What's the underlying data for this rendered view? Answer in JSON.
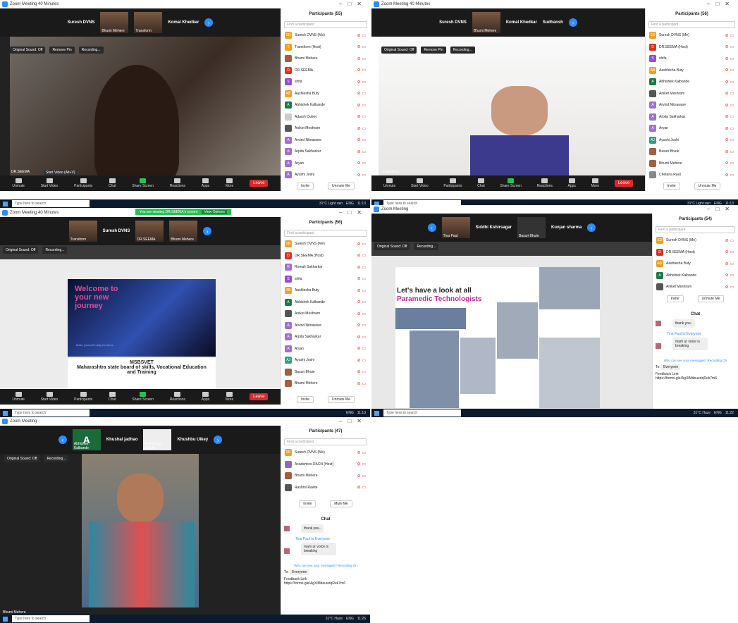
{
  "window_title": "Zoom Meeting 40 Minutes",
  "window_title_plain": "Zoom Meeting",
  "toolbar": {
    "unmute": "Unmute",
    "start_video": "Start Video",
    "participants": "Participants",
    "chat": "Chat",
    "share_screen": "Share Screen",
    "reactions": "Reactions",
    "apps": "Apps",
    "more": "More",
    "leave": "Leave",
    "view": "View"
  },
  "rec": {
    "original_sound": "Original Sound: Off",
    "remove_pin": "Remove Pin",
    "recording": "Recording..."
  },
  "taskbar": {
    "search": "Type here to search",
    "weather1": "31°C Light rain",
    "weather2": "31°C Haze",
    "lang": "ENG",
    "time1": "11:13",
    "time2": "11:22",
    "time3": "11:26",
    "date": "10-09-2022"
  },
  "shot1": {
    "strip_names": [
      "Suresh DVNS",
      "Bhumi Mehere",
      "Transform",
      "Komal Khedkar"
    ],
    "thumb_top": [
      "Suresh DVNS",
      "",
      "",
      "Komal Khedkar"
    ],
    "speaker": "DR.SEEMA",
    "tooltip": "Start Video (Alt+V)",
    "panel_title": "Participants (55)",
    "find": "Find a participant",
    "participants": [
      {
        "i": "SD",
        "n": "Suresh DVNS (Me)",
        "c": "#f0a020"
      },
      {
        "i": "T",
        "n": "Transform (Host)",
        "c": "#f0a020"
      },
      {
        "i": "",
        "n": "Bhumi Mehere",
        "c": "#a06040"
      },
      {
        "i": "D",
        "n": "DR.SEEMA",
        "c": "#e03020"
      },
      {
        "i": "S",
        "n": "shifa",
        "c": "#9050d0"
      },
      {
        "i": "AB",
        "n": "Aashlesha Buty",
        "c": "#f0a020"
      },
      {
        "i": "A",
        "n": "Abhishek Kalbande",
        "c": "#1a7a4a"
      },
      {
        "i": "",
        "n": "Adarsh Dubey",
        "c": "#ccc"
      },
      {
        "i": "",
        "n": "Aniket Meshram",
        "c": "#555"
      },
      {
        "i": "A",
        "n": "Arvind Nitnaware",
        "c": "#a070d0"
      },
      {
        "i": "A",
        "n": "Arpita Sakharkar",
        "c": "#a070d0"
      },
      {
        "i": "A",
        "n": "Aryan",
        "c": "#a070d0"
      },
      {
        "i": "A",
        "n": "Ayushi Joshi",
        "c": "#a070d0"
      }
    ],
    "invite": "Invite",
    "unmute_me": "Unmute Me"
  },
  "shot2": {
    "strip_names": [
      "Bhumi Mehere",
      "Komal Khedkar",
      "Sudhansh"
    ],
    "thumb_top": [
      "Suresh DVNS",
      "",
      "Komal Khedkar",
      "Sudhansh"
    ],
    "speaker": "Transform",
    "panel_title": "Participants (56)",
    "participants": [
      {
        "i": "SD",
        "n": "Suresh DVNS (Me)",
        "c": "#f0a020"
      },
      {
        "i": "D",
        "n": "DR.SEEMA (Host)",
        "c": "#e03020"
      },
      {
        "i": "S",
        "n": "shifa",
        "c": "#9050d0"
      },
      {
        "i": "AB",
        "n": "Aashlesha Buty",
        "c": "#f0a020"
      },
      {
        "i": "A",
        "n": "Abhishek Kalbande",
        "c": "#1a7a4a"
      },
      {
        "i": "",
        "n": "Aniket Meshram",
        "c": "#555"
      },
      {
        "i": "A",
        "n": "Arvind Nitnaware",
        "c": "#a070d0"
      },
      {
        "i": "A",
        "n": "Arpita Sakharkar",
        "c": "#a070d0"
      },
      {
        "i": "A",
        "n": "Aryan",
        "c": "#a070d0"
      },
      {
        "i": "AJ",
        "n": "Ayushi Joshi",
        "c": "#2aa080"
      },
      {
        "i": "",
        "n": "Basuri Bhute",
        "c": "#a06040"
      },
      {
        "i": "",
        "n": "Bhumi Mehere",
        "c": "#a06040"
      },
      {
        "i": "",
        "n": "Chetana Raut",
        "c": "#888"
      }
    ]
  },
  "shot3": {
    "banner": "You are viewing DR.SEEMA's screen",
    "view_options": "View Options",
    "strip_names": [
      "Transform",
      "DR.SEEMA",
      "Bhumi Mehere"
    ],
    "thumb_top": "Suresh DVNS",
    "panel_title": "Participants (56)",
    "participants": [
      {
        "i": "SD",
        "n": "Suresh DVNS (Me)",
        "c": "#f0a020"
      },
      {
        "i": "D",
        "n": "DR.SEEMA (Host)",
        "c": "#e03020"
      },
      {
        "i": "R",
        "n": "Romali Sakharkar",
        "c": "#a070d0"
      },
      {
        "i": "S",
        "n": "shifa",
        "c": "#9050d0"
      },
      {
        "i": "AB",
        "n": "Aashlesha Buty",
        "c": "#f0a020"
      },
      {
        "i": "A",
        "n": "Abhishek Kalbande",
        "c": "#1a7a4a"
      },
      {
        "i": "",
        "n": "Aniket Meshram",
        "c": "#555"
      },
      {
        "i": "A",
        "n": "Arvind Nitnaware",
        "c": "#a070d0"
      },
      {
        "i": "A",
        "n": "Arpita Sakharkar",
        "c": "#a070d0"
      },
      {
        "i": "A",
        "n": "Aryan",
        "c": "#a070d0"
      },
      {
        "i": "AJ",
        "n": "Ayushi Joshi",
        "c": "#2aa080"
      },
      {
        "i": "",
        "n": "Basuri Bhute",
        "c": "#a06040"
      },
      {
        "i": "",
        "n": "Bhumi Mehere",
        "c": "#a06040"
      }
    ],
    "slide_welcome": "Welcome to your new journey",
    "slide_small": "Make yourself ready for future",
    "slide_org": "MSBSVET",
    "slide_org_full": "Maharashtra state board of skills, Vocational Education and Training"
  },
  "shot4": {
    "strip_names": [
      "Tina Paul",
      "Basuri Bhute",
      "Siddhi Kshirsagar",
      "Kunjan sharma"
    ],
    "strip_top": [
      "Siddhi Kshirsagar",
      "Kunjan sharma"
    ],
    "panel_title": "Participants (54)",
    "participants": [
      {
        "i": "SD",
        "n": "Suresh DVNS (Me)",
        "c": "#f0a020"
      },
      {
        "i": "D",
        "n": "DR.SEEMA (Host)",
        "c": "#e03020"
      },
      {
        "i": "AB",
        "n": "Aashlesha Buty",
        "c": "#f0a020"
      },
      {
        "i": "A",
        "n": "Abhishek Kalbande",
        "c": "#1a7a4a"
      },
      {
        "i": "",
        "n": "Aniket Meshram",
        "c": "#555"
      }
    ],
    "slide_title1": "Let's have a look at all",
    "slide_title2": "Paramedic Technologists",
    "chat_title": "Chat",
    "chat_msg1": "thank you..",
    "chat_from": "Tina Paul to Everyone",
    "chat_msg2": "mam ur voice is breaking",
    "who_see": "Who can see your messages? Recording On",
    "to": "To:",
    "everyone": "Everyone",
    "feedback": "Feedback Link",
    "feedback_url": "https://forms.gle/AgXiMdeuedqRek7m6"
  },
  "shot5": {
    "strip_names": [
      "Abhishek Kalbande",
      "Khushal jadhao",
      "Academics DACN",
      "Khushbu Uikey"
    ],
    "strip_top": [
      "Khushal jadhao",
      "Khushbu Uikey"
    ],
    "panel_title": "Participants (47)",
    "participants": [
      {
        "i": "SD",
        "n": "Suresh DVNS (Me)",
        "c": "#f0a020"
      },
      {
        "i": "",
        "n": "Academics DACN (Host)",
        "c": "#8a6bbf"
      },
      {
        "i": "",
        "n": "Bhumi Mehere",
        "c": "#a06040"
      },
      {
        "i": "",
        "n": "Rashmi Rawte",
        "c": "#555"
      }
    ],
    "speaker": "Bhumi Mehere",
    "mute_me": "Mute Me",
    "feedback_url": "https://forms.gle/AgXiMdeuedqRek7m6"
  }
}
